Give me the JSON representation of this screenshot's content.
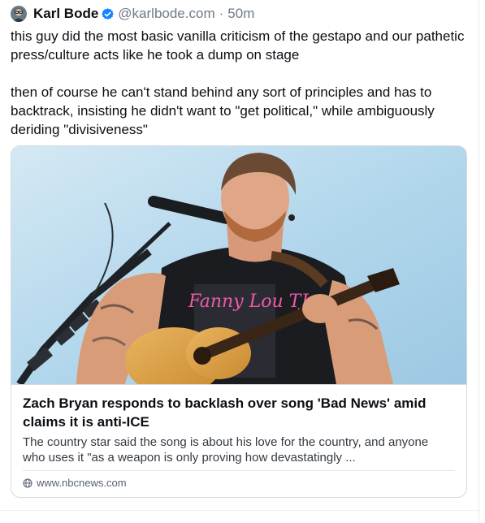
{
  "post": {
    "display_name": "Karl Bode",
    "handle": "@karlbode.com",
    "separator": "·",
    "time": "50m",
    "text": "this guy did the most basic vanilla criticism of the gestapo and our pathetic press/culture acts like he took a dump on stage\n\nthen of course he can't stand behind any sort of principles and has to backtrack, insisting he didn't want to \"get political,\" while ambiguously deriding \"divisiveness\""
  },
  "link_card": {
    "image_icon": "concert-photo",
    "shirt_text": "Fanny Lou TJ",
    "title": "Zach Bryan responds to backlash over song 'Bad News' amid claims it is anti-ICE",
    "description": "The country star said the song is about his love for the country, and anyone who uses it \"as a weapon is only proving how devastatingly ...",
    "domain": "www.nbcnews.com",
    "domain_icon": "globe-icon"
  },
  "colors": {
    "verified": "#1185fe",
    "muted_text": "#6f7a86",
    "border": "#d4d9df"
  }
}
